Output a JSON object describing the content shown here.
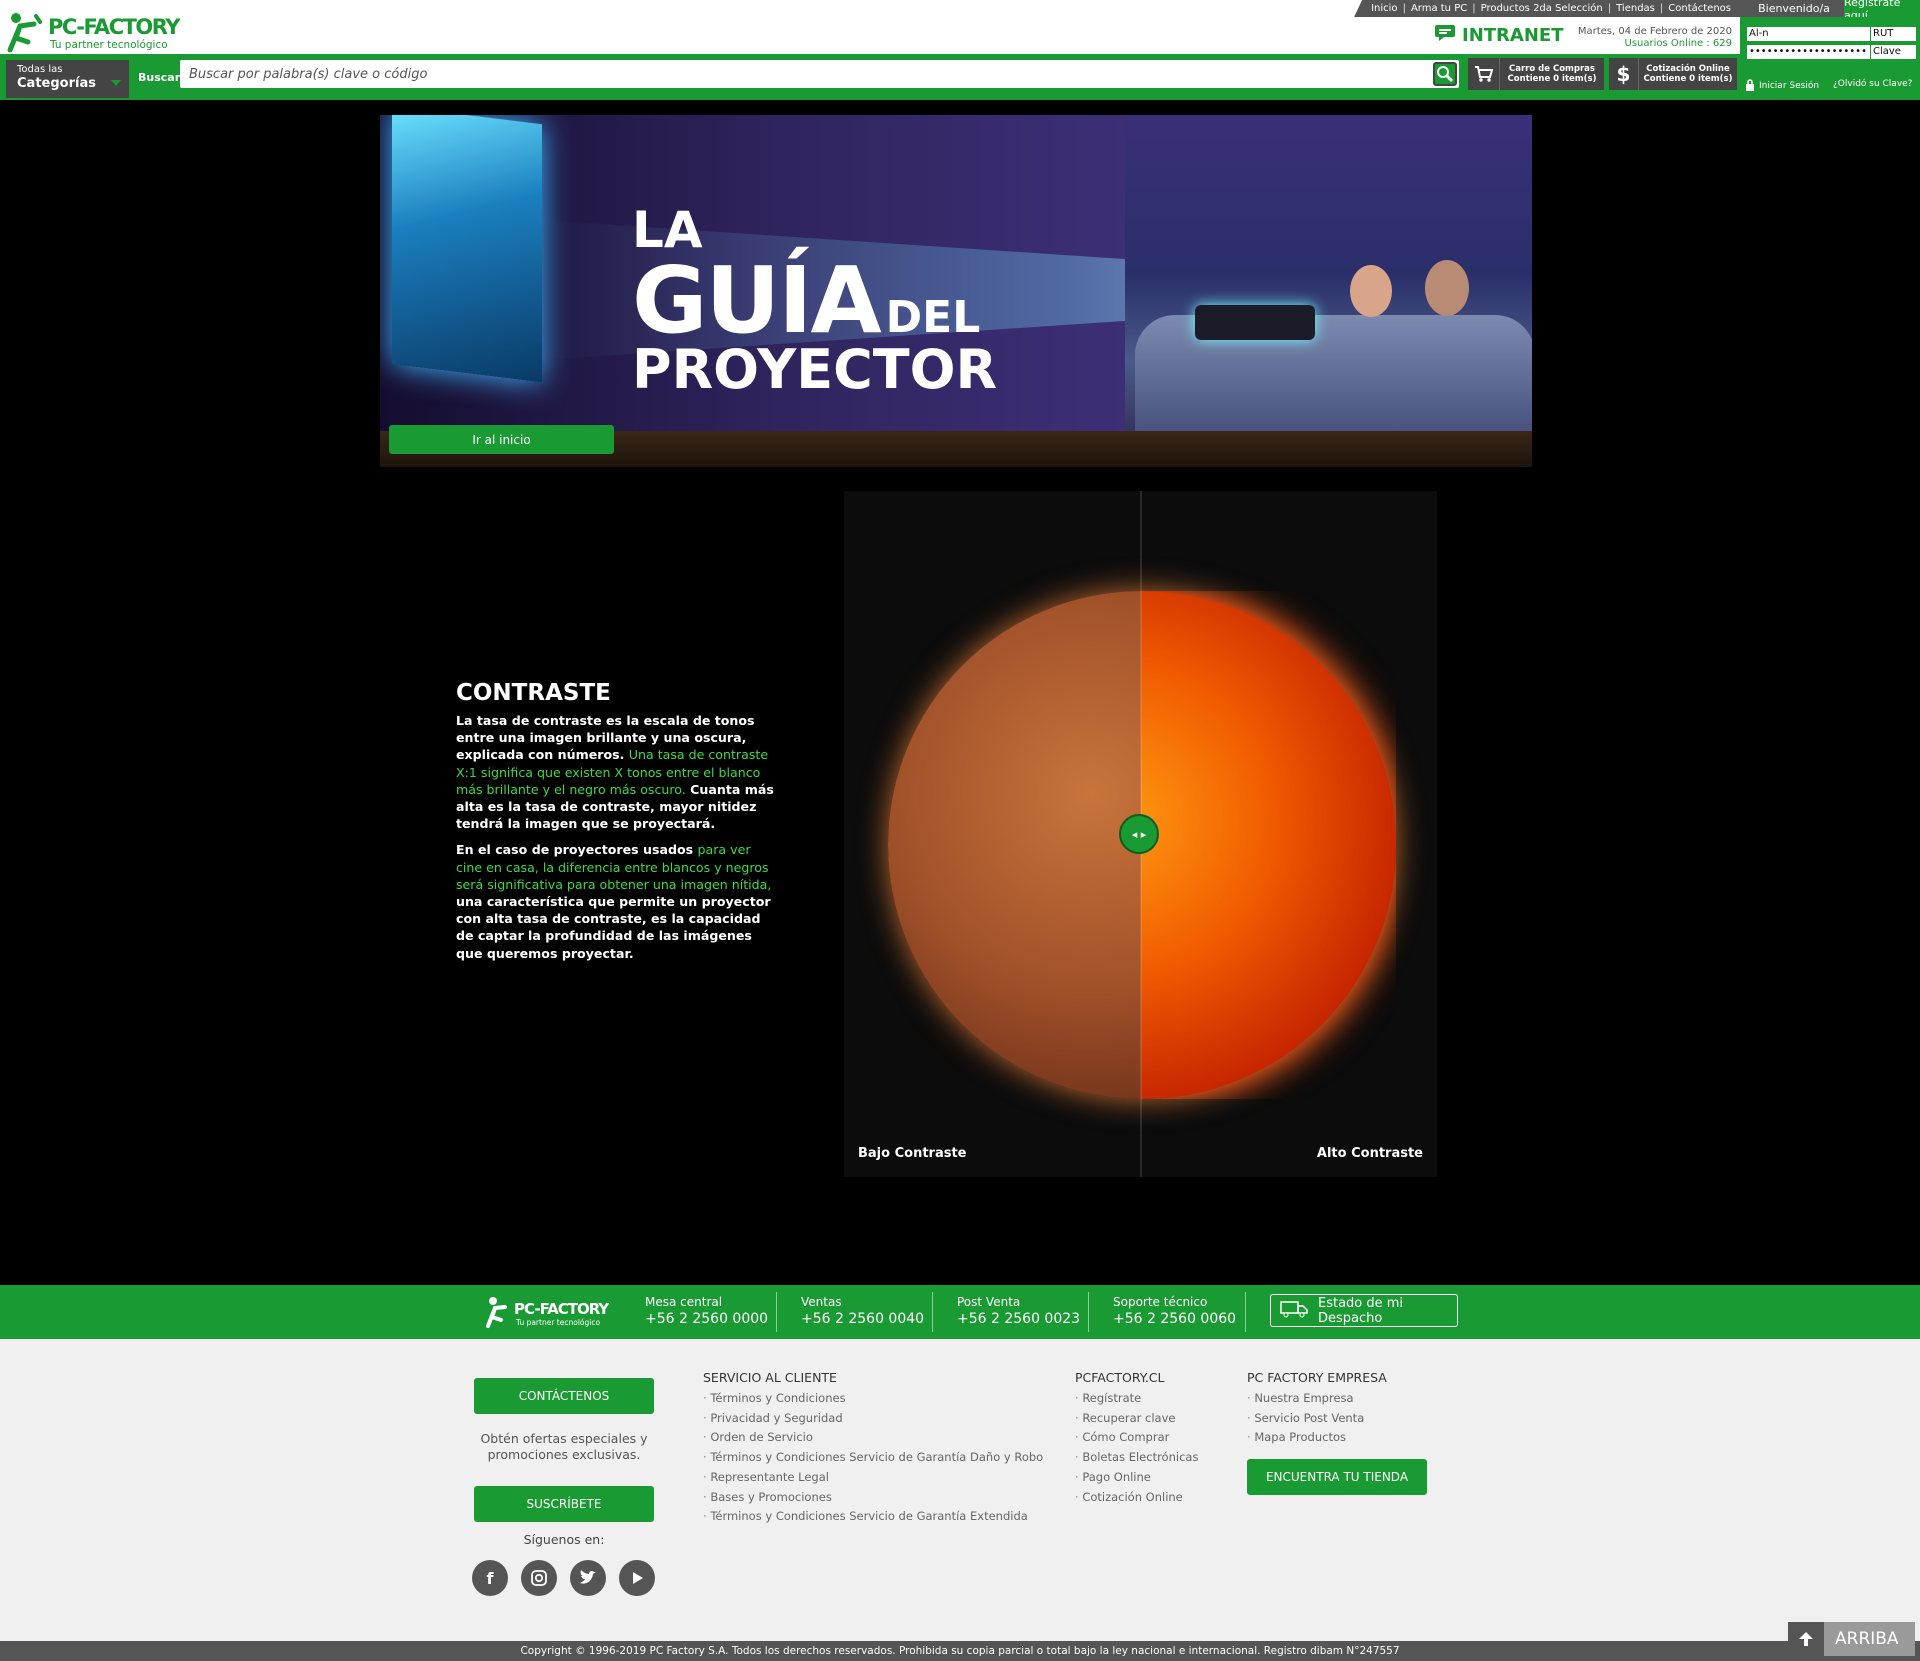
{
  "header": {
    "logo": {
      "brand": "PC-FACTORY",
      "tagline": "Tu partner tecnológico"
    },
    "top_links": [
      "Inicio",
      "Arma tu PC",
      "Productos 2da Selección",
      "Tiendas",
      "Contáctenos"
    ],
    "welcome": "Bienvenido/a",
    "register": "Regístrate aquí",
    "intranet": "INTRANET",
    "date": "Martes, 04 de Febrero de 2020",
    "online_users": "Usuarios Online : 629",
    "login": {
      "rut_value": "Al-n",
      "rut_label": "RUT",
      "password_value": "••••••••••••••••••••",
      "password_label": "Clave",
      "login_button": "Iniciar Sesión",
      "forgot": "¿Olvidó su Clave?"
    },
    "categories": {
      "small": "Todas las",
      "big": "Categorías"
    },
    "search_label": "Buscar:",
    "search_placeholder": "Buscar por palabra(s) clave o código",
    "cart": {
      "line1": "Carro de Compras",
      "line2": "Contiene 0 item(s)"
    },
    "quote": {
      "icon": "$",
      "line1": "Cotización Online",
      "line2": "Contiene 0 item(s)"
    }
  },
  "hero": {
    "title_l1": "LA",
    "title_l2": "GUÍA",
    "title_l2b": "DEL",
    "title_l3": "PROYECTOR",
    "button": "Ir al inicio"
  },
  "contrast": {
    "title": "CONTRASTE",
    "p1_a": "La tasa de contraste es la escala de tonos entre una imagen brillante y una oscura, explicada con números.",
    "p1_b": "Una tasa de contraste X:1 significa que existen X tonos entre el blanco más brillante y el negro más oscuro.",
    "p1_c": "Cuanta más alta es la tasa de contraste, mayor nitidez tendrá la imagen que se proyectará.",
    "p2_a": "En el caso de proyectores usados",
    "p2_b": "para ver cine en casa, la diferencia entre blancos y negros será significativa para obtener una imagen nítida,",
    "p2_c": "una característica que permite un proyector con alta tasa de contraste, es la capacidad de captar la profundidad de las imágenes que queremos proyectar.",
    "label_low": "Bajo Contraste",
    "label_high": "Alto Contraste",
    "slider_position": 0.5
  },
  "footer": {
    "logo": {
      "brand": "PC-FACTORY",
      "tagline": "Tu partner tecnológico"
    },
    "phones": [
      {
        "label": "Mesa central",
        "number": "+56 2 2560 0000"
      },
      {
        "label": "Ventas",
        "number": "+56 2 2560 0040"
      },
      {
        "label": "Post Venta",
        "number": "+56 2 2560 0023"
      },
      {
        "label": "Soporte técnico",
        "number": "+56 2 2560 0060"
      }
    ],
    "despacho": "Estado de mi Despacho",
    "contact_btn": "CONTÁCTENOS",
    "promo": "Obtén ofertas especiales y promociones exclusivas.",
    "subscribe_btn": "SUSCRÍBETE",
    "follow": "Síguenos en:",
    "col1": {
      "title": "SERVICIO AL CLIENTE",
      "items": [
        "Términos y Condiciones",
        "Privacidad y Seguridad",
        "Orden de Servicio",
        "Términos y Condiciones Servicio de Garantía Daño y Robo",
        "Representante Legal",
        "Bases y Promociones",
        "Términos y Condiciones Servicio de Garantía Extendida"
      ]
    },
    "col2": {
      "title": "PCFACTORY.CL",
      "items": [
        "Regístrate",
        "Recuperar clave",
        "Cómo Comprar",
        "Boletas Electrónicas",
        "Pago Online",
        "Cotización Online"
      ]
    },
    "col3": {
      "title": "PC FACTORY EMPRESA",
      "items": [
        "Nuestra Empresa",
        "Servicio Post Venta",
        "Mapa Productos"
      ]
    },
    "store_btn": "ENCUENTRA TU TIENDA",
    "copyright": "Copyright © 1996-2019 PC Factory S.A. Todos los derechos reservados. Prohibida su copia parcial o total bajo la ley nacional e internacional. Registro dibam N°247557",
    "arriba": "ARRIBA"
  },
  "colors": {
    "brand_green": "#1a9a32",
    "accent_green": "#3fd94a",
    "dark_gray": "#444444"
  }
}
